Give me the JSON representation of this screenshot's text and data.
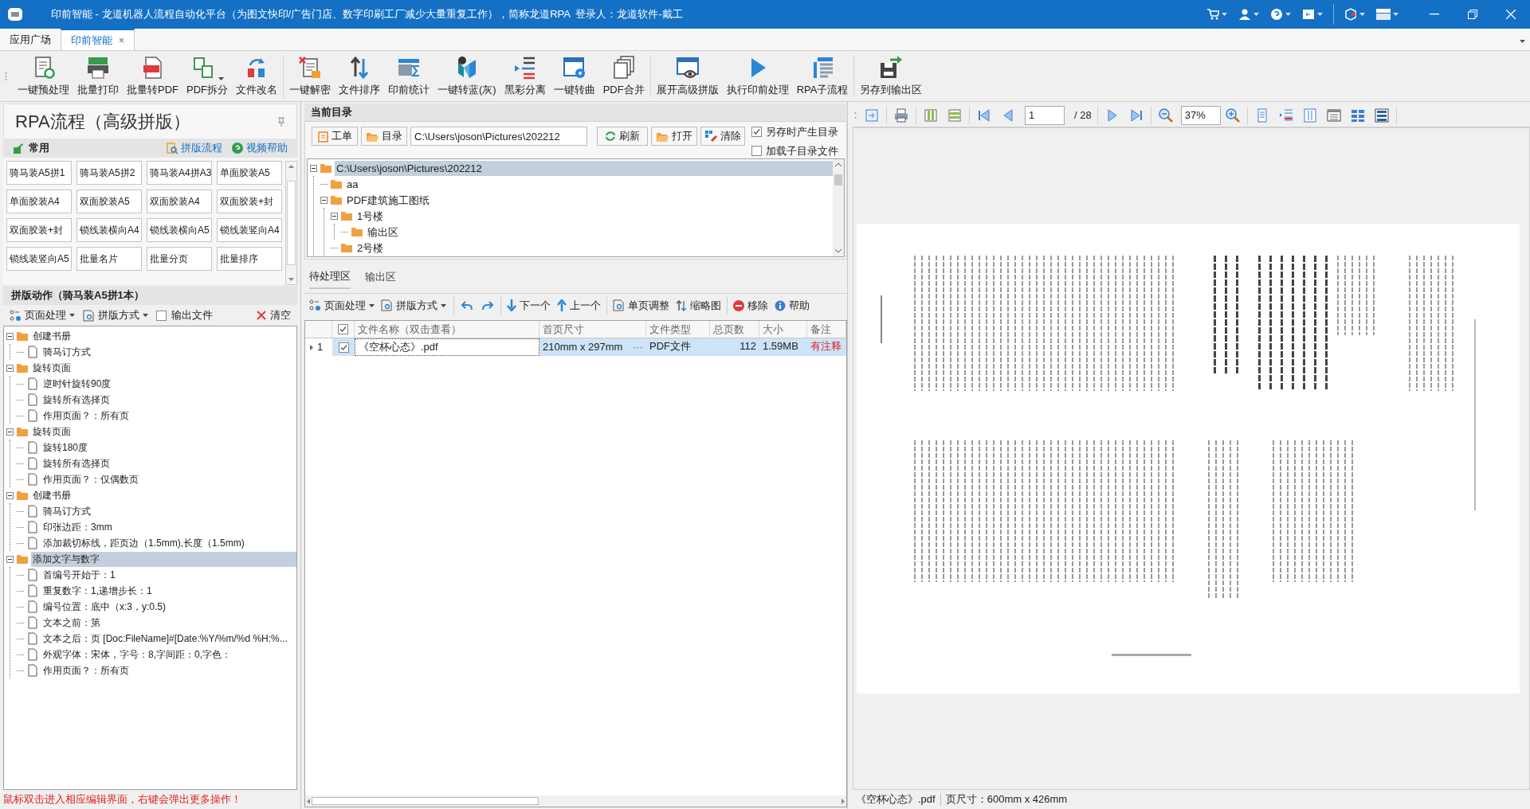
{
  "window": {
    "title": "印前智能 - 龙道机器人流程自动化平台（为图文快印/广告门店、数字印刷工厂减少大量重复工作），简称龙道RPA  登录人：龙道软件-戴工"
  },
  "app_tabs": [
    {
      "label": "应用广场",
      "selected": false
    },
    {
      "label": "印前智能",
      "selected": true,
      "close": "×"
    }
  ],
  "ribbon": [
    [
      {
        "label": "一键预处理"
      },
      {
        "label": "批量打印"
      },
      {
        "label": "批量转PDF"
      },
      {
        "label": "PDF拆分",
        "dropdown": true
      },
      {
        "label": "文件改名"
      }
    ],
    [
      {
        "label": "一键解密"
      },
      {
        "label": "文件排序"
      },
      {
        "label": "印前统计"
      },
      {
        "label": "一键转蓝(灰)"
      },
      {
        "label": "黑彩分离"
      },
      {
        "label": "一键转曲"
      },
      {
        "label": "PDF合并"
      }
    ],
    [
      {
        "label": "展开高级拼版"
      },
      {
        "label": "执行印前处理"
      },
      {
        "label": "RPA子流程"
      }
    ],
    [
      {
        "label": "另存到输出区"
      }
    ]
  ],
  "left_panel": {
    "title": "RPA流程（高级拼版）",
    "common_label": "常用",
    "links": [
      "拼版流程",
      "视频帮助"
    ],
    "presets": [
      "骑马装A5拼1",
      "骑马装A5拼2",
      "骑马装A4拼A3",
      "单面胶装A5",
      "单面胶装A4",
      "双面胶装A5",
      "双面胶装A4",
      "双面胶装+封",
      "双面胶装+封",
      "锁线装横向A4",
      "锁线装横向A5",
      "锁线装竖向A4",
      "锁线装竖向A5",
      "批量名片",
      "批量分页",
      "批量排序"
    ]
  },
  "actions": {
    "title": "拼版动作（骑马装A5拼1本）",
    "page_menu": "页面处理",
    "layout_menu": "拼版方式",
    "output_file": {
      "label": "输出文件",
      "checked": false
    },
    "clear": "清空",
    "tree": [
      {
        "label": "创建书册",
        "expanded": true,
        "selected": false,
        "children": [
          {
            "label": "骑马订方式",
            "selected": false
          }
        ]
      },
      {
        "label": "旋转页面",
        "expanded": true,
        "selected": false,
        "children": [
          {
            "label": "逆时针旋转90度",
            "selected": false
          },
          {
            "label": "旋转所有选择页",
            "selected": false
          },
          {
            "label": "作用页面？：所有页",
            "selected": false
          }
        ]
      },
      {
        "label": "旋转页面",
        "expanded": true,
        "selected": false,
        "children": [
          {
            "label": "旋转180度",
            "selected": false
          },
          {
            "label": "旋转所有选择页",
            "selected": false
          },
          {
            "label": "作用页面？：仅偶数页",
            "selected": false
          }
        ]
      },
      {
        "label": "创建书册",
        "expanded": true,
        "selected": false,
        "children": [
          {
            "label": "骑马订方式",
            "selected": false
          },
          {
            "label": "印张边距：3mm",
            "selected": false
          },
          {
            "label": "添加裁切标线，距页边（1.5mm),长度（1.5mm)",
            "selected": false
          }
        ]
      },
      {
        "label": "添加文字与数字",
        "expanded": true,
        "selected": true,
        "children": [
          {
            "label": "首编号开始于：1",
            "selected": false
          },
          {
            "label": "重复数字：1,递增步长：1",
            "selected": false
          },
          {
            "label": "编号位置：底中（x:3，y:0.5)",
            "selected": false
          },
          {
            "label": "文本之前：第",
            "selected": false
          },
          {
            "label": "文本之后：页 [Doc:FileName]#[Date:%Y/%m/%d %H:%...",
            "selected": false
          },
          {
            "label": "外观字体：宋体，字号：8,字间距：0,字色：",
            "selected": false
          },
          {
            "label": "作用页面？：所有页",
            "selected": false
          }
        ]
      }
    ],
    "hint": "鼠标双击进入相应编辑界面，右键会弹出更多操作！"
  },
  "directory": {
    "title": "当前目录",
    "ticket": "工单",
    "folder": "目录",
    "path": "C:\\Users\\joson\\Pictures\\202212",
    "refresh": "刷新",
    "open": "打开",
    "clear": "清除",
    "options": [
      {
        "label": "另存时产生目录",
        "checked": true
      },
      {
        "label": "加载子目录文件",
        "checked": false
      }
    ],
    "tree": [
      {
        "label": "C:\\Users\\joson\\Pictures\\202212",
        "expanded": true,
        "selected": true,
        "children": [
          {
            "label": "aa",
            "selected": false
          },
          {
            "label": "PDF建筑施工图纸",
            "expanded": true,
            "selected": false,
            "children": [
              {
                "label": "1号楼",
                "expanded": true,
                "selected": false,
                "children": [
                  {
                    "label": "输出区",
                    "selected": false
                  }
                ]
              },
              {
                "label": "2号楼",
                "selected": false
              }
            ]
          }
        ]
      }
    ]
  },
  "work_tabs": [
    {
      "label": "待处理区",
      "selected": true
    },
    {
      "label": "输出区",
      "selected": false
    }
  ],
  "file_toolbar": {
    "page_menu": "页面处理",
    "layout_menu": "拼版方式",
    "next": "下一个",
    "previous": "上一个",
    "single_page": "单页调整",
    "thumbnails": "缩略图",
    "remove": "移除",
    "help": "帮助"
  },
  "files": {
    "header_checked": true,
    "columns": [
      "文件名称（双击查看）",
      "首页尺寸",
      "文件类型",
      "总页数",
      "大小",
      "备注"
    ],
    "rows": [
      {
        "index": "1",
        "checked": true,
        "selected": true,
        "cells": [
          "《空杯心态》.pdf",
          "210mm x 297mm",
          "PDF文件",
          "112",
          "1.59MB",
          "有注释"
        ],
        "more": "···"
      }
    ]
  },
  "viewer": {
    "page": "1",
    "page_count": "/ 28",
    "zoom": "37%",
    "page_preview": {
      "kind": "picture"
    },
    "status": [
      "《空杯心态》.pdf",
      "页尺寸：600mm x 426mm"
    ]
  }
}
